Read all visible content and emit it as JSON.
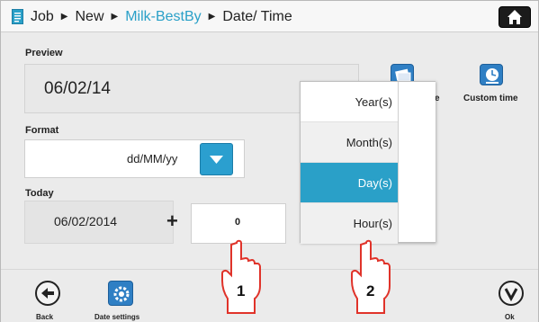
{
  "breadcrumb": {
    "items": [
      "Job",
      "New",
      "Milk-BestBy",
      "Date/ Time"
    ]
  },
  "preview": {
    "label": "Preview",
    "value": "06/02/14"
  },
  "format": {
    "label": "Format",
    "value": "dd/MM/yy"
  },
  "today": {
    "label": "Today",
    "value": "06/02/2014",
    "operator": "+",
    "offset": "0"
  },
  "side_tools": {
    "partial_label": "e",
    "custom_time_label": "Custom time"
  },
  "dropdown": {
    "options": [
      "Year(s)",
      "Month(s)",
      "Day(s)",
      "Hour(s)"
    ],
    "selected": "Day(s)"
  },
  "footer": {
    "back_label": "Back",
    "date_settings_label": "Date settings",
    "ok_label": "Ok"
  },
  "markers": [
    "1",
    "2"
  ],
  "colors": {
    "accent": "#2aa0c8",
    "selection": "#2aa0c8",
    "dropdown_button": "#2b9fcf",
    "marker": "#e0332a"
  },
  "icons": [
    "document-icon",
    "home-icon",
    "calendar-stack-icon",
    "calendar-clock-icon",
    "chevron-down-icon",
    "back-arrow-icon",
    "gear-icon",
    "checkmark-icon",
    "pointing-hand-icon"
  ]
}
